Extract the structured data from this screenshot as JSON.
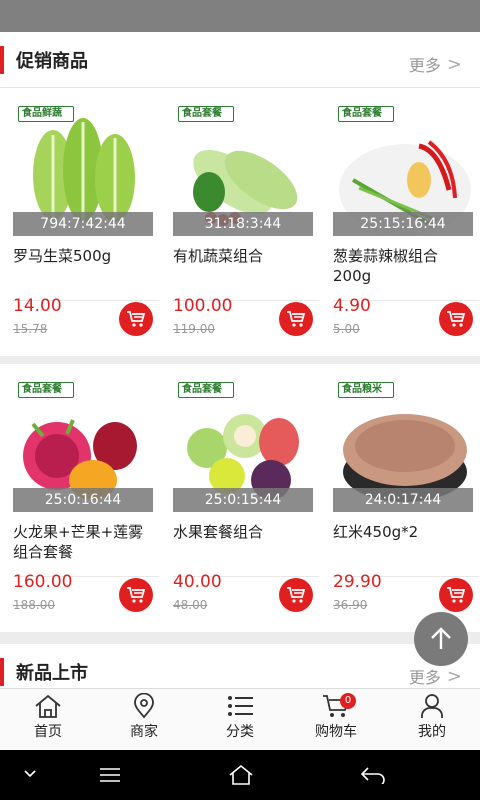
{
  "promo": {
    "title": "促销商品",
    "more": "更多",
    "products": [
      {
        "badge": "食品鲜蔬",
        "timer": "794:7:42:44",
        "name": "罗马生菜500g",
        "price": "14.00",
        "old_price": "15.78",
        "icon": "romaine-lettuce"
      },
      {
        "badge": "食品套餐",
        "timer": "31:18:3:44",
        "name": "有机蔬菜组合",
        "price": "100.00",
        "old_price": "119.00",
        "icon": "vegetable-combo"
      },
      {
        "badge": "食品套餐",
        "timer": "25:15:16:44",
        "name": "葱姜蒜辣椒组合200g",
        "price": "4.90",
        "old_price": "5.00",
        "icon": "spice-combo"
      },
      {
        "badge": "食品套餐",
        "timer": "25:0:16:44",
        "name": "火龙果+芒果+莲雾组合套餐",
        "price": "160.00",
        "old_price": "188.00",
        "icon": "dragonfruit-combo"
      },
      {
        "badge": "食品套餐",
        "timer": "25:0:15:44",
        "name": "水果套餐组合",
        "price": "40.00",
        "old_price": "48.00",
        "icon": "fruit-combo"
      },
      {
        "badge": "食品粮米",
        "timer": "24:0:17:44",
        "name": "红米450g*2",
        "price": "29.90",
        "old_price": "36.90",
        "icon": "red-rice"
      }
    ]
  },
  "new_arrivals": {
    "title": "新品上市",
    "more": "更多"
  },
  "tabbar": [
    {
      "label": "首页",
      "icon": "home-icon"
    },
    {
      "label": "商家",
      "icon": "location-pin-icon"
    },
    {
      "label": "分类",
      "icon": "list-icon"
    },
    {
      "label": "购物车",
      "icon": "cart-icon",
      "count": "0"
    },
    {
      "label": "我的",
      "icon": "user-icon"
    }
  ],
  "colors": {
    "accent": "#e02020",
    "badge_green": "#2e7d32"
  }
}
